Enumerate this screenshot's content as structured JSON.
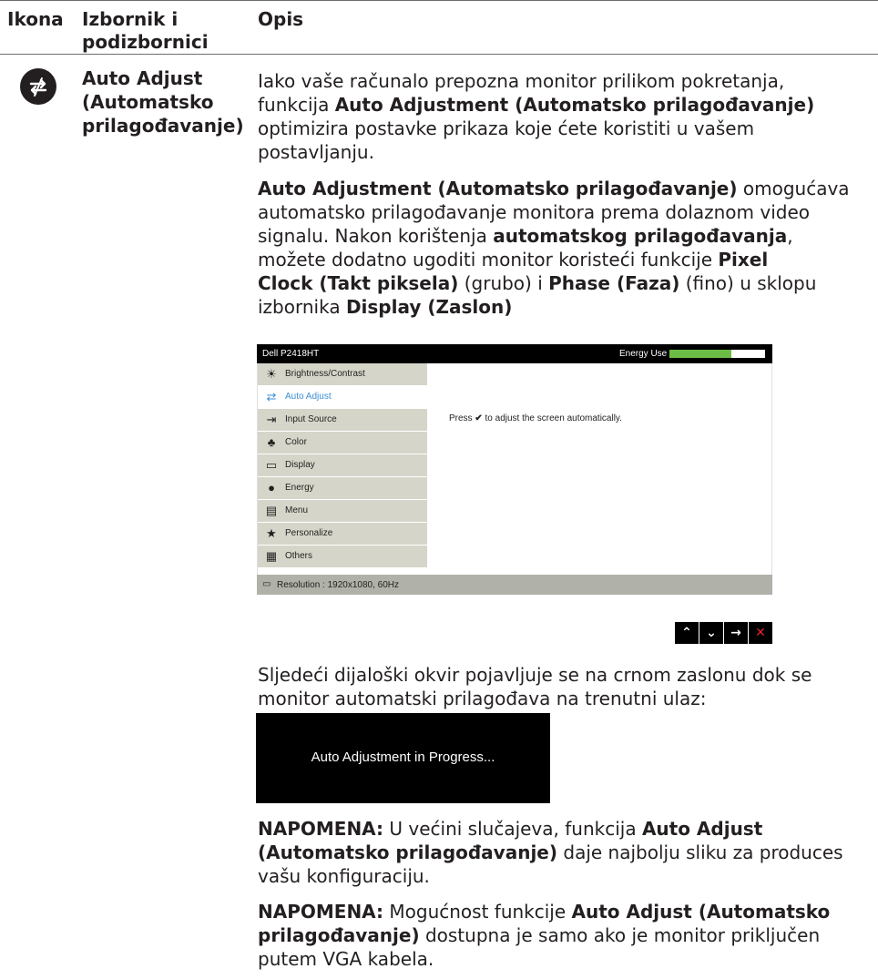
{
  "header": {
    "col_icon": "Ikona",
    "col_menu_line1": "Izbornik i",
    "col_menu_line2": "podizbornici",
    "col_desc": "Opis"
  },
  "feature": {
    "icon": "auto-adjust-icon",
    "name_line1": "Auto Adjust",
    "name_line2": "(Automatsko",
    "name_line3": "prilagođavanje)"
  },
  "para1": {
    "l1": "Iako vaše računalo prepozna monitor prilikom pokretanja,",
    "l2_pre": "funkcija ",
    "l2_b": "Auto Adjustment (Automatsko prilagođavanje)",
    "l3": "optimizira postavke prikaza koje ćete koristiti u vašem",
    "l4": "postavljanju."
  },
  "para2": {
    "l1_b": "Auto Adjustment (Automatsko prilagođavanje)",
    "l1_post": " omogućava",
    "l2": "automatsko prilagođavanje monitora prema dolaznom video",
    "l3_pre": "signalu. Nakon korištenja ",
    "l3_b": "automatskog prilagođavanja",
    "l3_post": ",",
    "l4_pre": "možete dodatno ugoditi monitor koristeći funkcije ",
    "l4_b": "Pixel",
    "l5_b": "Clock (Takt piksela)",
    "l5_mid": " (grubo) i ",
    "l5_b2": "Phase (Faza)",
    "l5_post": " (fino) u sklopu",
    "l6_pre": "izbornika ",
    "l6_b": "Display (Zaslon)"
  },
  "osd": {
    "model": "Dell P2418HT",
    "energy_label": "Energy Use",
    "energy_level": 0.65,
    "energy_color": "#6bbd45",
    "selected_color": "#3b8fd4",
    "menu": [
      {
        "label": "Brightness/Contrast",
        "icon": "sun-icon",
        "glyph": "☀"
      },
      {
        "label": "Auto Adjust",
        "icon": "auto-adjust-icon",
        "glyph": "⇄"
      },
      {
        "label": "Input Source",
        "icon": "input-source-icon",
        "glyph": "⇥"
      },
      {
        "label": "Color",
        "icon": "color-icon",
        "glyph": "♣"
      },
      {
        "label": "Display",
        "icon": "display-icon",
        "glyph": "▭"
      },
      {
        "label": "Energy",
        "icon": "energy-icon",
        "glyph": "●"
      },
      {
        "label": "Menu",
        "icon": "menu-icon",
        "glyph": "▤"
      },
      {
        "label": "Personalize",
        "icon": "star-icon",
        "glyph": "★"
      },
      {
        "label": "Others",
        "icon": "others-icon",
        "glyph": "▦"
      }
    ],
    "message_pre": "Press ",
    "message_check": "✔",
    "message_post": " to adjust the screen automatically.",
    "resolution": "Resolution : 1920x1080, 60Hz"
  },
  "nav_buttons": [
    {
      "icon": "up-icon",
      "glyph": "⌃"
    },
    {
      "icon": "down-icon",
      "glyph": "⌄"
    },
    {
      "icon": "right-arrow-icon",
      "glyph": "→"
    },
    {
      "icon": "close-icon",
      "glyph": "✕"
    }
  ],
  "para3": {
    "l1": "Sljedeći dijaloški okvir pojavljuje se na crnom zaslonu dok se",
    "l2": "monitor automatski prilagođava na trenutni ulaz:"
  },
  "progress_box": "Auto Adjustment in Progress...",
  "note1": {
    "l1_b": "NAPOMENA:",
    "l1_mid": " U većini slučajeva, funkcija ",
    "l1_b2": "Auto Adjust",
    "l2_b": "(Automatsko prilagođavanje)",
    "l2_post": " daje najbolju sliku za produces",
    "l3": "vašu konfiguraciju."
  },
  "note2": {
    "l1_b": "NAPOMENA:",
    "l1_mid": " Mogućnost funkcije ",
    "l1_b2": "Auto Adjust (Automatsko",
    "l2_b": "prilagođavanje)",
    "l2_post": " dostupna je samo ako je monitor priključen",
    "l3": "putem VGA kabela."
  }
}
